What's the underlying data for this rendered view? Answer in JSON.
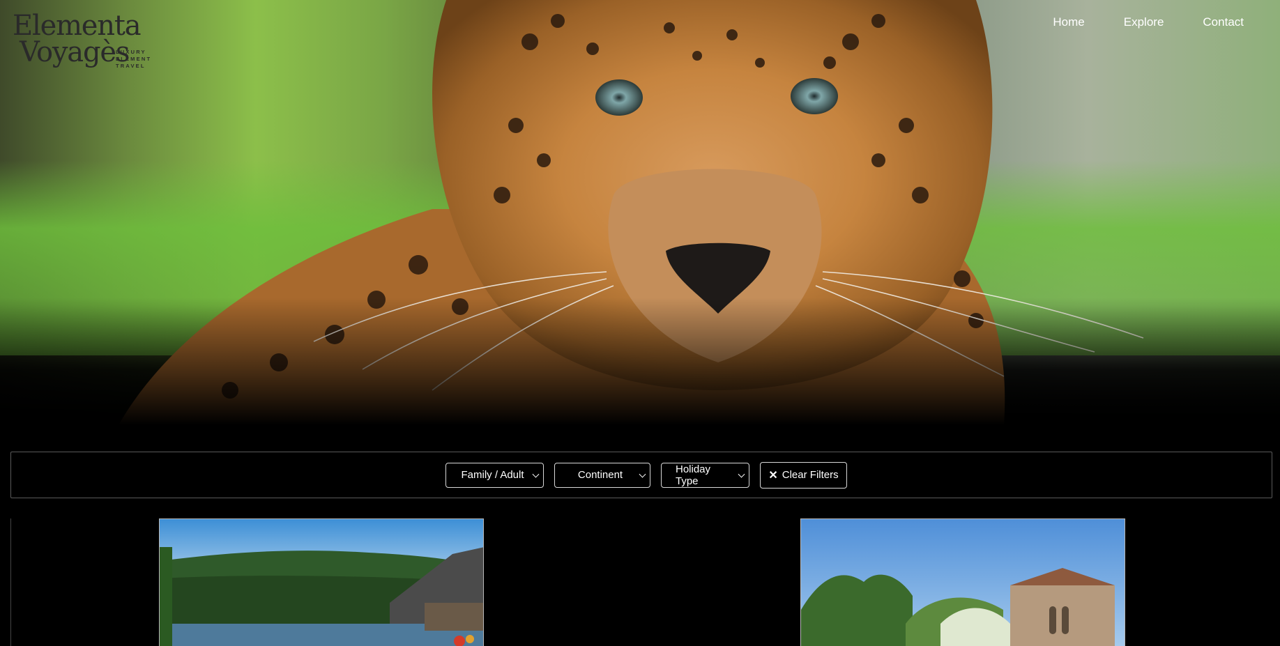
{
  "brand": {
    "name_line1": "Elementa",
    "name_line2": "Voyagès",
    "tagline": [
      "LUXURY",
      "ELEMENT",
      "TRAVEL"
    ]
  },
  "nav": {
    "items": [
      "Home",
      "Explore",
      "Contact"
    ]
  },
  "hero": {
    "image_subject": "leopard close-up"
  },
  "filters": {
    "family_adult": "Family / Adult",
    "continent": "Continent",
    "holiday_type": "Holiday Type",
    "clear_label": "Clear Filters",
    "clear_icon": "close-icon"
  },
  "cards": [
    {
      "image_subject": "lake with forested hills and chalet"
    },
    {
      "image_subject": "stone chapel among trees"
    }
  ],
  "colors": {
    "background": "#000000",
    "text": "#ffffff",
    "border": "#d8d8d8"
  }
}
